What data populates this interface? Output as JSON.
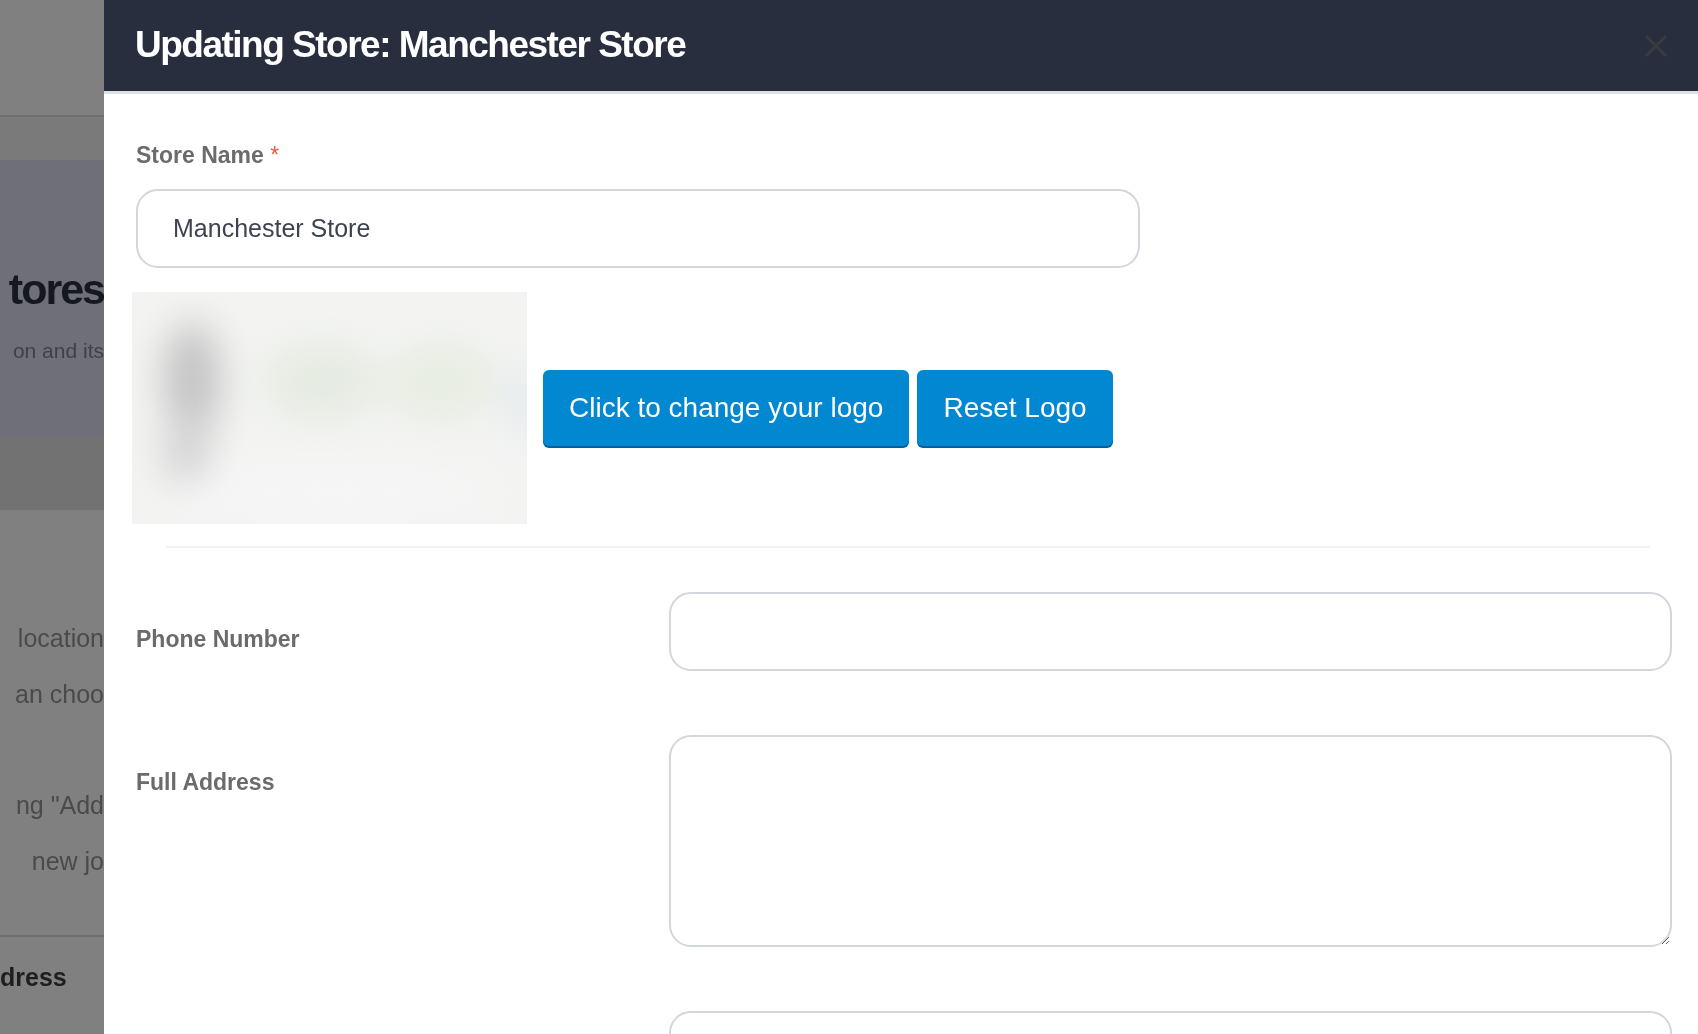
{
  "background_page": {
    "heading": "tores",
    "subtitle": "on and its",
    "lines": [
      "location",
      "an choo",
      "ng \"Add",
      "new jo"
    ],
    "footer": "dress"
  },
  "modal": {
    "title": "Updating Store: Manchester Store",
    "store_name": {
      "label": "Store Name",
      "required_mark": "*",
      "value": "Manchester Store"
    },
    "logo": {
      "kind": "picture",
      "buttons": [
        "Click to change your logo",
        "Reset Logo"
      ]
    },
    "fields": [
      {
        "label": "Phone Number",
        "kind": "input"
      },
      {
        "label": "Full Address",
        "kind": "textarea"
      },
      {
        "kind": "input"
      }
    ]
  }
}
